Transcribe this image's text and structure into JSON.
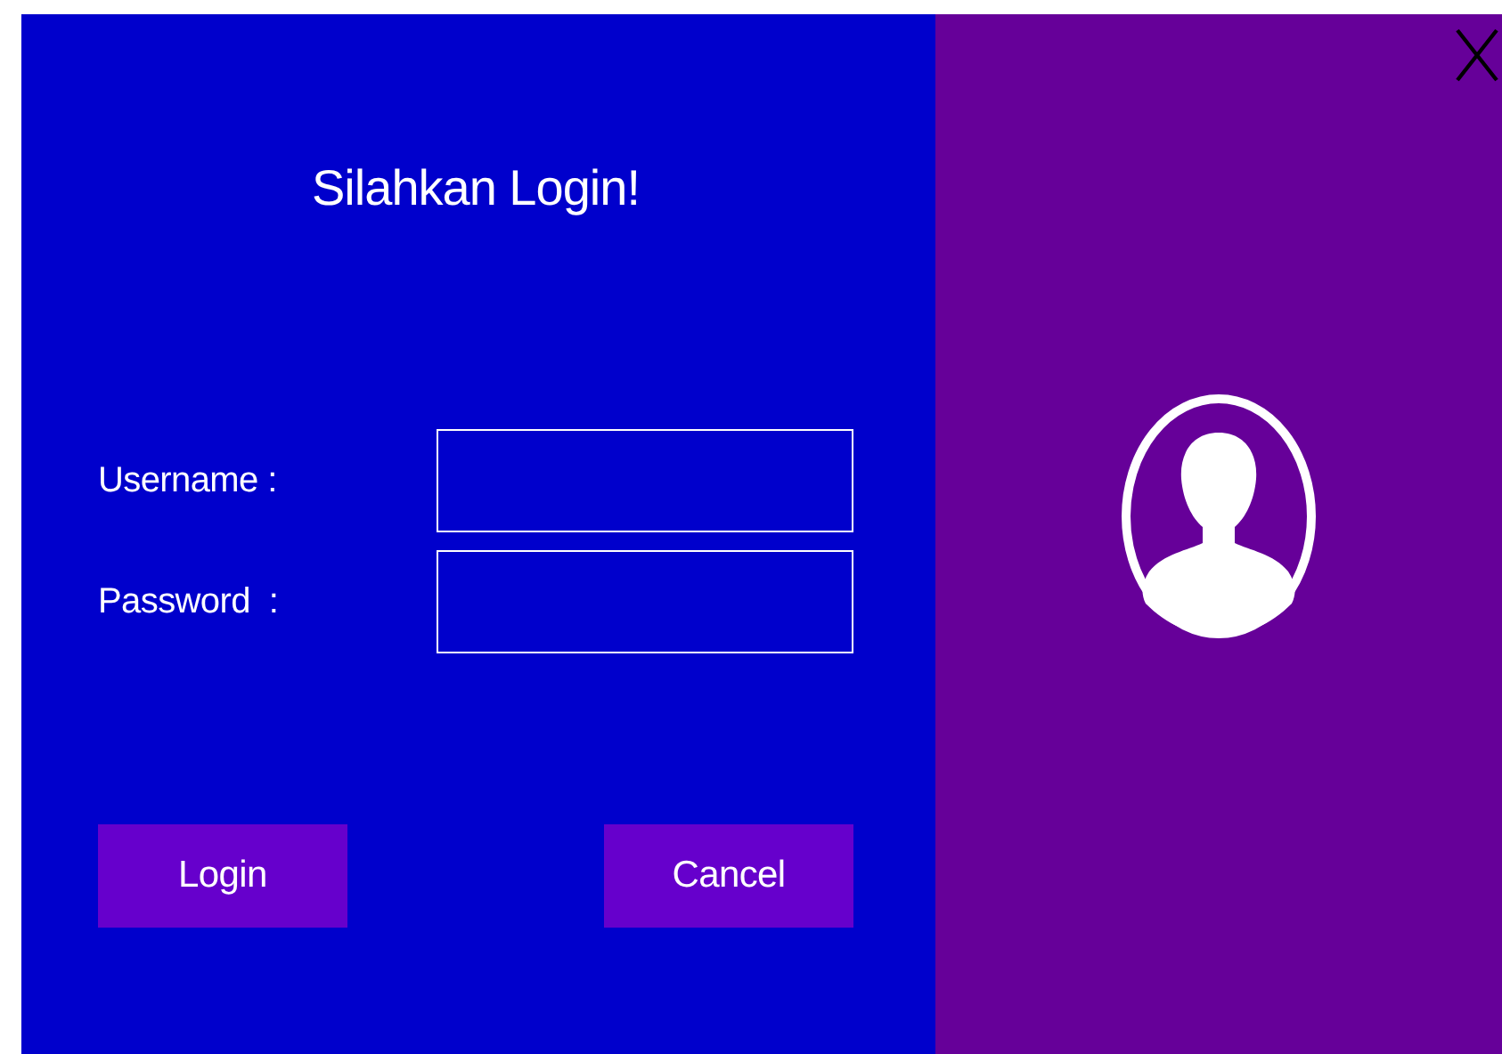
{
  "title": "Silahkan Login!",
  "fields": [
    {
      "label": "Username :"
    },
    {
      "label": "Password  :"
    }
  ],
  "buttons": [
    "Login",
    "Cancel"
  ]
}
